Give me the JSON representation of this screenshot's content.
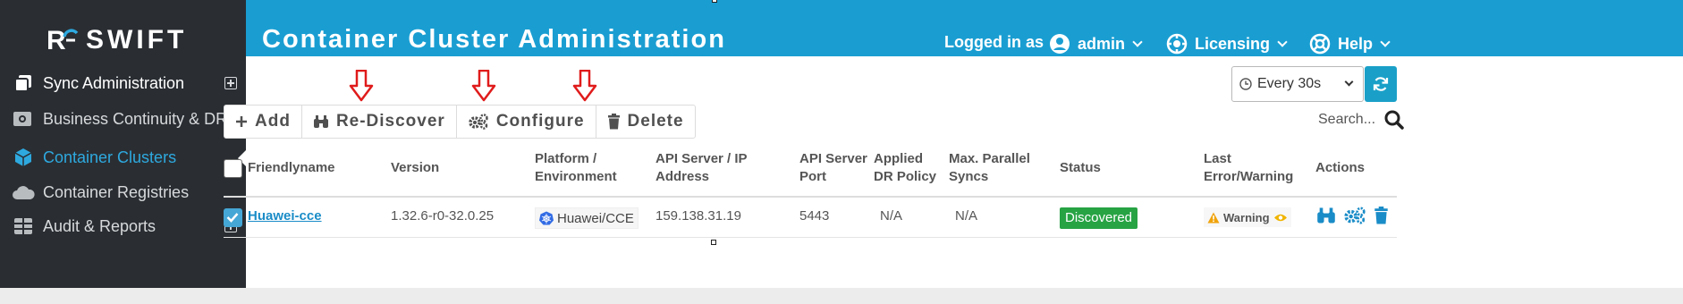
{
  "app": {
    "logo_text": "SWIFT",
    "logo_letter": "R"
  },
  "sidebar": {
    "items": [
      {
        "label": "Sync Administration",
        "icon": "copy-icon",
        "expandable": true
      },
      {
        "label": "Business Continuity & DR",
        "icon": "server-cog-icon",
        "expandable": true
      },
      {
        "label": "Container Clusters",
        "icon": "cube-icon",
        "active": true
      },
      {
        "label": "Container Registries",
        "icon": "cloud-icon"
      },
      {
        "label": "Audit & Reports",
        "icon": "table-icon",
        "expandable": true
      }
    ]
  },
  "header": {
    "title": "Container Cluster Administration",
    "logged_in_label": "Logged in as",
    "user": "admin",
    "licensing": "Licensing",
    "help": "Help"
  },
  "toolbar": {
    "add": "Add",
    "rediscover": "Re-Discover",
    "configure": "Configure",
    "delete": "Delete"
  },
  "refresh": {
    "selected": "Every 30s"
  },
  "search": {
    "placeholder": "Search..."
  },
  "table": {
    "headers": {
      "friendlyname": "Friendlyname",
      "version": "Version",
      "platform_1": "Platform /",
      "platform_2": "Environment",
      "api_1": "API Server / IP",
      "api_2": "Address",
      "port_1": "API Server",
      "port_2": "Port",
      "policy_1": "Applied",
      "policy_2": "DR Policy",
      "syncs_1": "Max. Parallel",
      "syncs_2": "Syncs",
      "status": "Status",
      "last_1": "Last",
      "last_2": "Error/Warning",
      "actions": "Actions"
    },
    "rows": [
      {
        "name": "Huawei-cce",
        "version": "1.32.6-r0-32.0.25",
        "platform": "Huawei/CCE",
        "api": "159.138.31.19",
        "port": "5443",
        "policy": "N/A",
        "syncs": "N/A",
        "status": "Discovered",
        "last": "Warning",
        "checked": true
      }
    ]
  },
  "colors": {
    "sidebar_bg": "#2a2e33",
    "header_bg": "#1a9ed2",
    "active_link": "#2ea9df",
    "status_ok": "#27a344",
    "annotation_arrow": "#e01b1b"
  }
}
